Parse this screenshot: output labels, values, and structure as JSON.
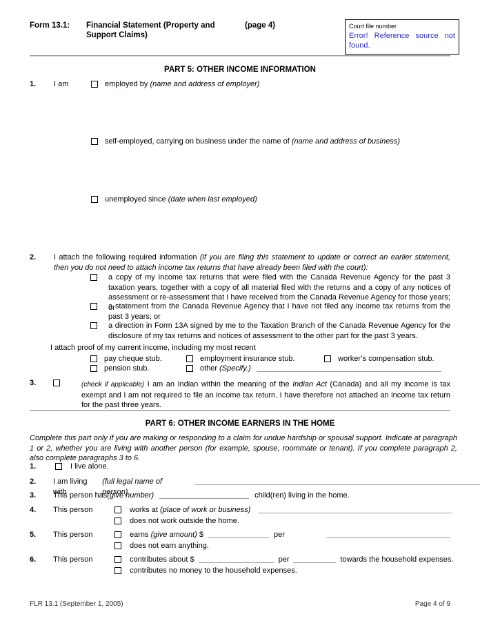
{
  "header": {
    "form_label": "Form 13.1:",
    "form_name": "Financial Statement (Property and Support Claims)",
    "page_marker": "(page 4)",
    "court_box_label": "Court file number",
    "court_box_error": "Error! Reference source not found."
  },
  "part5": {
    "heading": "PART 5: OTHER INCOME INFORMATION",
    "item1": {
      "number": "1.",
      "lead": "I am",
      "options": [
        {
          "text": "employed by ",
          "hint": "(name and address of employer)"
        },
        {
          "text": "self-employed, carrying on business under the name of ",
          "hint": "(name and address of business)"
        },
        {
          "text": "unemployed since ",
          "hint": "(date when last employed)"
        }
      ]
    },
    "item2": {
      "number": "2.",
      "intro_plain": "I attach the following required information ",
      "intro_italic": "(if you are filing this statement to update or correct an earlier statement, then you do not need to attach income tax returns that have already been filed with the court):",
      "options": [
        "a copy of my income tax returns that were filed with the Canada Revenue Agency for the past 3 taxation years, together with a copy of all material filed with the returns and a copy of any notices of assessment or re-assessment that I have received from the Canada Revenue Agency for those years; or",
        "a statement from the Canada Revenue Agency that I have not filed any income tax returns from the past 3 years; or",
        "a direction in Form 13A signed by me to the Taxation Branch of the Canada Revenue Agency for the disclosure of my tax returns and notices of assessment to the other part for the past 3 years."
      ],
      "proof_intro": "I attach proof of my current income, including my most recent",
      "proof_options_row1": [
        "pay cheque stub.",
        "employment insurance stub.",
        "worker’s compensation stub."
      ],
      "proof_options_row2": [
        "pension stub.",
        "other "
      ],
      "proof_other_hint": "(Specify.)"
    },
    "item3": {
      "number": "3.",
      "hint": "(check if applicable)",
      "text_a": " I am an Indian within the meaning of the ",
      "italic_act": "Indian Act",
      "text_b": " (Canada) and all my income is tax exempt and I am not required to file an income tax return. I have therefore not attached an income tax return for the past three years."
    }
  },
  "part6": {
    "heading": "PART 6: OTHER INCOME EARNERS IN THE HOME",
    "intro": "Complete this part only if you are making or responding to a claim for undue hardship or spousal support. Indicate at paragraph 1 or 2, whether you are living with another person (for example, spouse, roommate or tenant). If you complete paragraph 2, also complete paragraphs 3 to 6.",
    "items": [
      {
        "number": "1.",
        "label": "I live alone."
      },
      {
        "number": "2.",
        "lead": "I am living with ",
        "hint": "(full legal name of person)"
      },
      {
        "number": "3.",
        "lead": "This person has ",
        "hint": "(give number)",
        "tail": "child(ren) living in the home."
      },
      {
        "number": "4.",
        "lead": "This person",
        "option1_a": "works at ",
        "option1_hint": "(place of work or business)",
        "option2": "does not work outside the home."
      },
      {
        "number": "5.",
        "lead": "This person",
        "option1_a": "earns ",
        "option1_hint": "(give amount)",
        "option1_b": " $",
        "option1_per": "per",
        "option2": "does not earn anything."
      },
      {
        "number": "6.",
        "lead": "This person",
        "option1_a": "contributes about $",
        "option1_per": "per",
        "option1_tail": "towards the household expenses.",
        "option2": "contributes no money to the household expenses."
      }
    ]
  },
  "footer": {
    "left": "FLR 13.1 (September 1, 2005)",
    "right": "Page 4 of 9"
  }
}
